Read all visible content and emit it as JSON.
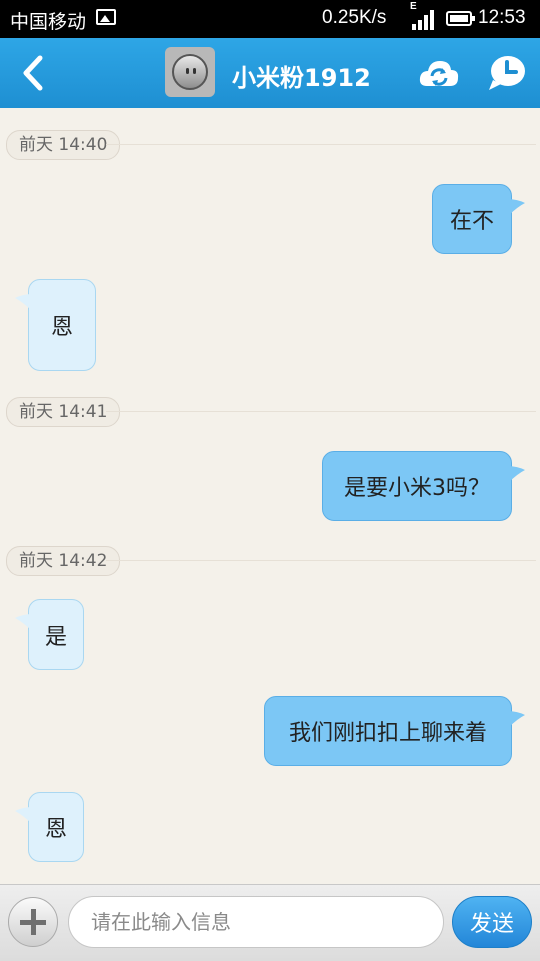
{
  "status_bar": {
    "carrier": "中国移动",
    "network_speed": "0.25K/s",
    "network_type": "E",
    "time": "12:53"
  },
  "header": {
    "title": "小米粉1912"
  },
  "messages": [
    {
      "type": "time",
      "text": "前天 14:40"
    },
    {
      "type": "sent",
      "text": "在不"
    },
    {
      "type": "received",
      "text": "恩"
    },
    {
      "type": "time",
      "text": "前天 14:41"
    },
    {
      "type": "sent",
      "text": "是要小米3吗？"
    },
    {
      "type": "time",
      "text": "前天 14:42"
    },
    {
      "type": "received",
      "text": "是"
    },
    {
      "type": "sent",
      "text": "我们刚扣扣上聊来着"
    },
    {
      "type": "received",
      "text": "恩"
    }
  ],
  "composer": {
    "placeholder": "请在此输入信息",
    "send_label": "发送"
  },
  "colors": {
    "title_bar": "#1e8fd2",
    "sent_bubble": "#7cc7f5",
    "received_bubble": "#def1fc",
    "background": "#f4f1ea"
  }
}
